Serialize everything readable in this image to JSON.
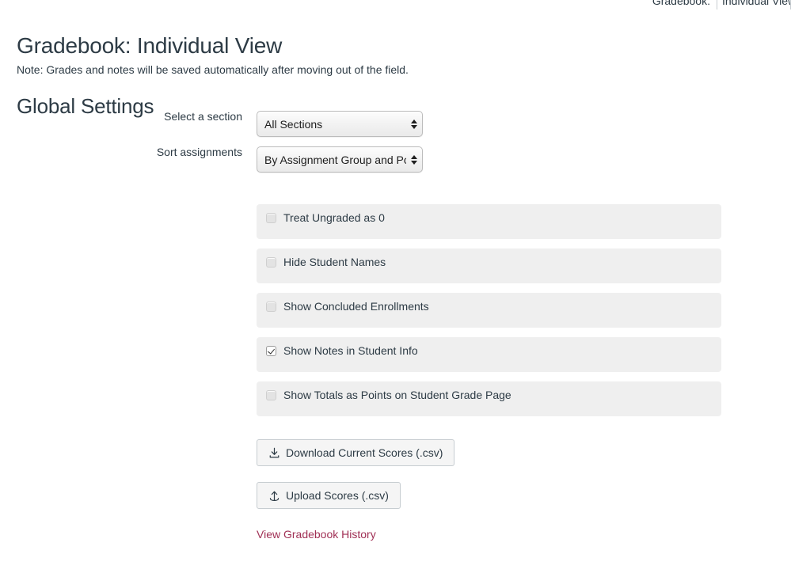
{
  "top_bar": {
    "switcher_label": "Gradebook:",
    "switcher_value": "Individual View"
  },
  "page": {
    "title": "Gradebook: Individual View",
    "note": "Note: Grades and notes will be saved automatically after moving out of the field.",
    "section_heading": "Global Settings"
  },
  "fields": [
    {
      "label": "Select a section",
      "value": "All Sections",
      "name": "section-select"
    },
    {
      "label": "Sort assignments",
      "value": "By Assignment Group and Posit",
      "name": "sort-assignments-select"
    }
  ],
  "checkboxes": [
    {
      "label": "Treat Ungraded as 0",
      "checked": false,
      "name": "checkbox-treat-ungraded-as-zero"
    },
    {
      "label": "Hide Student Names",
      "checked": false,
      "name": "checkbox-hide-student-names"
    },
    {
      "label": "Show Concluded Enrollments",
      "checked": false,
      "name": "checkbox-show-concluded-enrollments"
    },
    {
      "label": "Show Notes in Student Info",
      "checked": true,
      "name": "checkbox-show-notes-in-student-info"
    },
    {
      "label": "Show Totals as Points on Student Grade Page",
      "checked": false,
      "name": "checkbox-show-totals-as-points"
    }
  ],
  "buttons": {
    "download": {
      "label": "Download Current Scores (.csv)",
      "icon": "download-icon"
    },
    "upload": {
      "label": "Upload Scores (.csv)",
      "icon": "upload-icon"
    }
  },
  "links": {
    "history": "View Gradebook History"
  },
  "colors": {
    "text": "#2d3b45",
    "link": "#a03055",
    "panel": "#efefef",
    "button_border": "#c7cdd1"
  }
}
